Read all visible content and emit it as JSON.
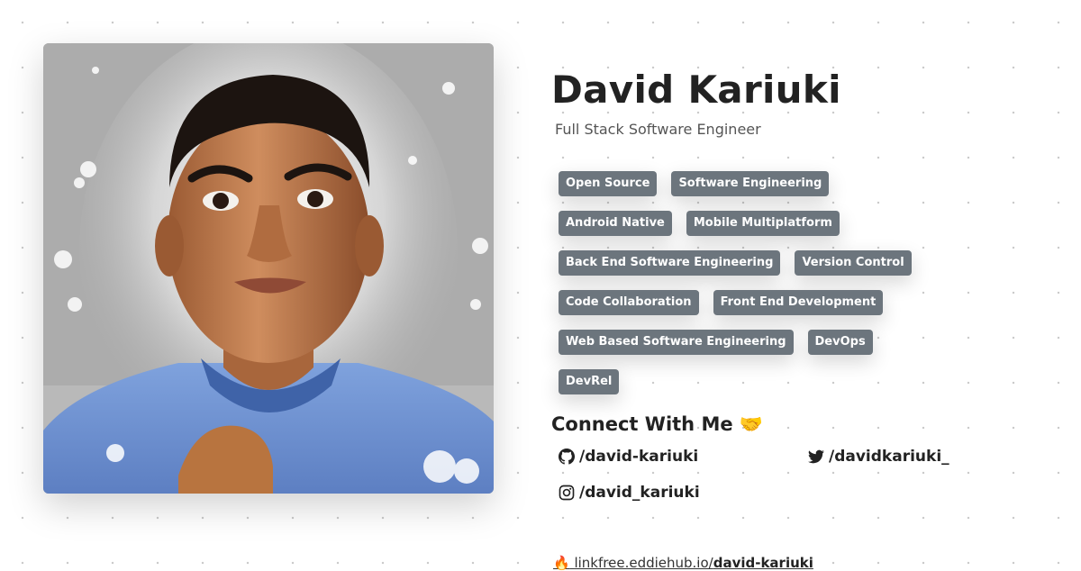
{
  "profile": {
    "name": "David Kariuki",
    "role": "Full Stack Software Engineer",
    "avatar_alt": "Portrait of David Kariuki"
  },
  "tags": [
    [
      "Open Source",
      "Software Engineering"
    ],
    [
      "Android Native",
      "Mobile Multiplatform"
    ],
    [
      "Back End Software Engineering",
      "Version Control"
    ],
    [
      "Code Collaboration",
      "Front End Development"
    ],
    [
      "Web Based Software Engineering",
      "DevOps"
    ],
    [
      "DevRel"
    ]
  ],
  "connect": {
    "title": "Connect With Me 🤝",
    "links": [
      {
        "icon": "github-icon",
        "label": "/david-kariuki"
      },
      {
        "icon": "twitter-icon",
        "label": "/davidkariuki_"
      },
      {
        "icon": "instagram-icon",
        "label": "/david_kariuki"
      }
    ]
  },
  "linkfree": {
    "icon": "fire-icon",
    "prefix": "linkfree.eddiehub.io/",
    "handle": "david-kariuki"
  },
  "colors": {
    "tag_bg": "#6c757d",
    "tag_text": "#ffffff",
    "text_primary": "#222222",
    "text_secondary": "#555555"
  }
}
